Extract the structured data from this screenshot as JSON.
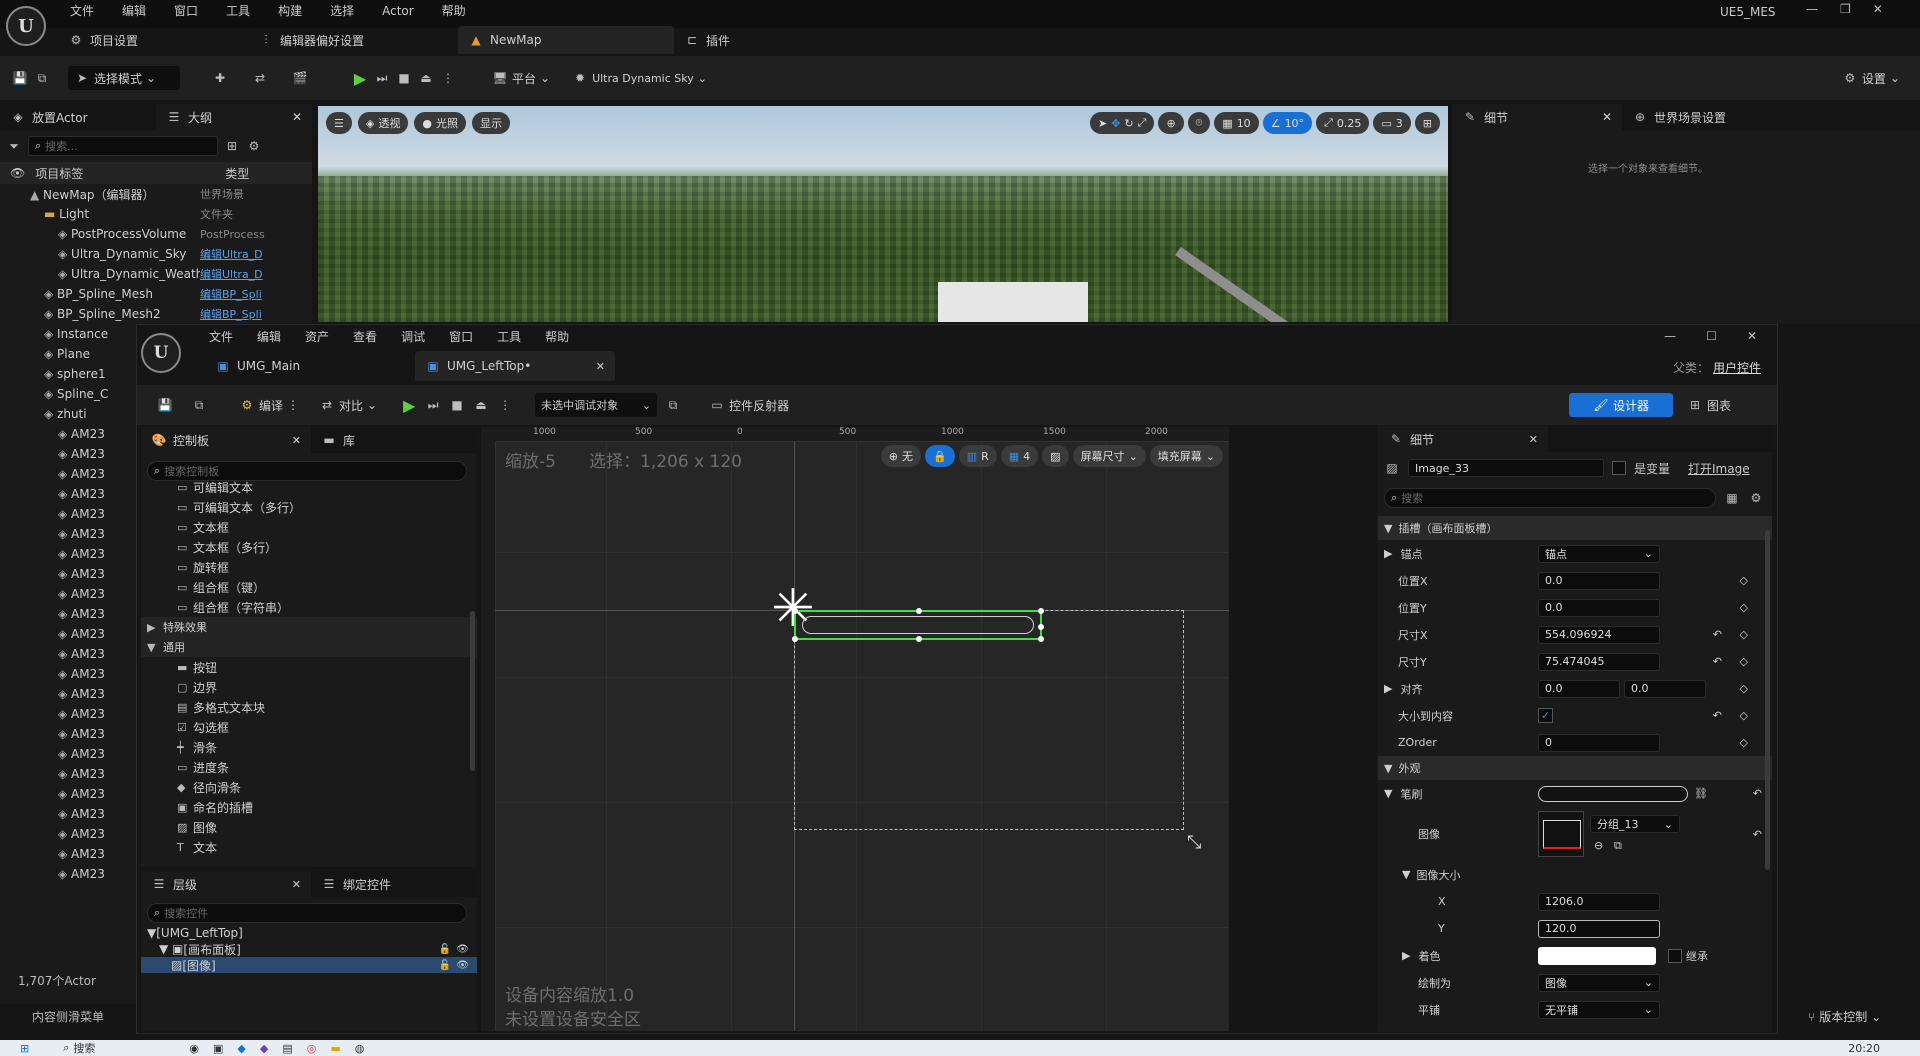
{
  "main_menu": [
    "文件",
    "编辑",
    "窗口",
    "工具",
    "构建",
    "选择",
    "Actor",
    "帮助"
  ],
  "project_name": "UE5_MES",
  "main_tabs": [
    {
      "label": "项目设置"
    },
    {
      "label": "编辑器偏好设置"
    },
    {
      "label": "NewMap"
    },
    {
      "label": "插件"
    }
  ],
  "main_toolbar": {
    "select_mode": "选择模式",
    "platform": "平台",
    "sky": "Ultra Dynamic Sky",
    "settings": "设置"
  },
  "left_panel": {
    "tab_place": "放置Actor",
    "tab_outline": "大纲",
    "search_placeholder": "搜索...",
    "col_label": "项目标签",
    "col_type": "类型",
    "rows": [
      {
        "label": "NewMap（编辑器）",
        "type": "世界场景",
        "indent": 0
      },
      {
        "label": "Light",
        "type": "文件夹",
        "indent": 1
      },
      {
        "label": "PostProcessVolume",
        "type": "PostProcess",
        "indent": 2
      },
      {
        "label": "Ultra_Dynamic_Sky",
        "type": "编辑Ultra_D",
        "indent": 2
      },
      {
        "label": "Ultra_Dynamic_Weath",
        "type": "编辑Ultra_D",
        "indent": 2
      },
      {
        "label": "BP_Spline_Mesh",
        "type": "编辑BP_Spli",
        "indent": 1
      },
      {
        "label": "BP_Spline_Mesh2",
        "type": "编辑BP_Spli",
        "indent": 1
      },
      {
        "label": "Instance",
        "type": "",
        "indent": 1
      },
      {
        "label": "Plane",
        "type": "",
        "indent": 1
      },
      {
        "label": "sphere1",
        "type": "",
        "indent": 1
      },
      {
        "label": "Spline_C",
        "type": "",
        "indent": 1
      },
      {
        "label": "zhuti",
        "type": "",
        "indent": 1
      },
      {
        "label": "AM23",
        "type": "",
        "indent": 2
      },
      {
        "label": "AM23",
        "type": "",
        "indent": 2
      },
      {
        "label": "AM23",
        "type": "",
        "indent": 2
      },
      {
        "label": "AM23",
        "type": "",
        "indent": 2
      },
      {
        "label": "AM23",
        "type": "",
        "indent": 2
      },
      {
        "label": "AM23",
        "type": "",
        "indent": 2
      },
      {
        "label": "AM23",
        "type": "",
        "indent": 2
      },
      {
        "label": "AM23",
        "type": "",
        "indent": 2
      },
      {
        "label": "AM23",
        "type": "",
        "indent": 2
      },
      {
        "label": "AM23",
        "type": "",
        "indent": 2
      },
      {
        "label": "AM23",
        "type": "",
        "indent": 2
      },
      {
        "label": "AM23",
        "type": "",
        "indent": 2
      },
      {
        "label": "AM23",
        "type": "",
        "indent": 2
      },
      {
        "label": "AM23",
        "type": "",
        "indent": 2
      },
      {
        "label": "AM23",
        "type": "",
        "indent": 2
      },
      {
        "label": "AM23",
        "type": "",
        "indent": 2
      },
      {
        "label": "AM23",
        "type": "",
        "indent": 2
      },
      {
        "label": "AM23",
        "type": "",
        "indent": 2
      },
      {
        "label": "AM23",
        "type": "",
        "indent": 2
      },
      {
        "label": "AM23",
        "type": "",
        "indent": 2
      },
      {
        "label": "AM23",
        "type": "",
        "indent": 2
      },
      {
        "label": "AM23",
        "type": "",
        "indent": 2
      },
      {
        "label": "AM23",
        "type": "",
        "indent": 2
      }
    ],
    "actor_count": "1,707个Actor",
    "content_drawer": "内容侧滑菜单"
  },
  "viewport": {
    "perspective": "透视",
    "lit": "光照",
    "show": "显示",
    "grid": "10",
    "angle": "10°",
    "scale": "0.25",
    "cam": "3"
  },
  "right_panel": {
    "tab_details": "细节",
    "tab_world": "世界场景设置",
    "hint": "选择一个对象来查看细节。"
  },
  "umg": {
    "menu": [
      "文件",
      "编辑",
      "资产",
      "查看",
      "调试",
      "窗口",
      "工具",
      "帮助"
    ],
    "tabs": [
      {
        "label": "UMG_Main"
      },
      {
        "label": "UMG_LeftTop•"
      }
    ],
    "parent_label": "父类：",
    "parent_value": "用户控件",
    "toolbar": {
      "compile": "编译",
      "diff": "对比",
      "debug_target": "未选中调试对象",
      "reflector": "控件反射器",
      "designer": "设计器",
      "graph": "图表"
    },
    "palette": {
      "tab": "控制板",
      "tab_lib": "库",
      "search_placeholder": "搜索控制板",
      "items": [
        {
          "label": "可编辑文本",
          "icon": "▭",
          "kind": "item"
        },
        {
          "label": "可编辑文本（多行）",
          "icon": "▭",
          "kind": "item"
        },
        {
          "label": "文本框",
          "icon": "▭",
          "kind": "item"
        },
        {
          "label": "文本框（多行）",
          "icon": "▭",
          "kind": "item"
        },
        {
          "label": "旋转框",
          "icon": "▭",
          "kind": "item"
        },
        {
          "label": "组合框（键）",
          "icon": "▭",
          "kind": "item"
        },
        {
          "label": "组合框（字符串）",
          "icon": "▭",
          "kind": "item"
        },
        {
          "label": "特殊效果",
          "icon": "▶",
          "kind": "cat"
        },
        {
          "label": "通用",
          "icon": "▼",
          "kind": "cat"
        },
        {
          "label": "按钮",
          "icon": "▬",
          "kind": "item"
        },
        {
          "label": "边界",
          "icon": "▢",
          "kind": "item"
        },
        {
          "label": "多格式文本块",
          "icon": "▤",
          "kind": "item"
        },
        {
          "label": "勾选框",
          "icon": "☑",
          "kind": "item"
        },
        {
          "label": "滑条",
          "icon": "┿",
          "kind": "item"
        },
        {
          "label": "进度条",
          "icon": "▭",
          "kind": "item"
        },
        {
          "label": "径向滑条",
          "icon": "◆",
          "kind": "item"
        },
        {
          "label": "命名的插槽",
          "icon": "▣",
          "kind": "item"
        },
        {
          "label": "图像",
          "icon": "▨",
          "kind": "item"
        },
        {
          "label": "文本",
          "icon": "T",
          "kind": "item"
        }
      ]
    },
    "hierarchy": {
      "tab": "层级",
      "tab_bind": "绑定控件",
      "search_placeholder": "搜索控件",
      "rows": [
        {
          "label": "[UMG_LeftTop]",
          "indent": 0
        },
        {
          "label": "[画布面板]",
          "indent": 1
        },
        {
          "label": "[图像]",
          "indent": 2
        }
      ]
    },
    "canvas": {
      "zoom": "缩放-5",
      "selection": "选择：1,206 x 120",
      "device_scale": "设备内容缩放1.0",
      "safe_zone": "未设置设备安全区",
      "ruler_marks": [
        "1000",
        "500",
        "0",
        "500",
        "1000",
        "1500",
        "2000"
      ],
      "no_label": "无",
      "r_label": "R",
      "grid_value": "4",
      "screen_size": "屏幕尺寸",
      "fill_screen": "填充屏幕"
    },
    "details": {
      "tab": "细节",
      "name_value": "Image_33",
      "is_variable": "是变量",
      "open_image": "打开Image",
      "search_placeholder": "搜索",
      "slot_header": "插槽（画布面板槽）",
      "anchor_label": "锚点",
      "anchor_value": "锚点",
      "pos_x_label": "位置X",
      "pos_x": "0.0",
      "pos_y_label": "位置Y",
      "pos_y": "0.0",
      "size_x_label": "尺寸X",
      "size_x": "554.096924",
      "size_y_label": "尺寸Y",
      "size_y": "75.474045",
      "align_label": "对齐",
      "align_x": "0.0",
      "align_y": "0.0",
      "autosize_label": "大小到内容",
      "zorder_label": "ZOrder",
      "zorder": "0",
      "appearance_header": "外观",
      "brush_label": "笔刷",
      "image_label": "图像",
      "image_value": "分组_13",
      "image_size_label": "图像大小",
      "img_x_label": "X",
      "img_x": "1206.0",
      "img_y_label": "Y",
      "img_y": "120.0",
      "tint_label": "着色",
      "inherit": "继承",
      "draw_as_label": "绘制为",
      "draw_as": "图像",
      "tiling_label": "平铺",
      "tiling": "无平铺"
    }
  },
  "status": {
    "version_control": "版本控制",
    "clock": "20:20"
  },
  "taskbar": {
    "search": "搜索"
  },
  "colors": {
    "accent": "#1a6fd4",
    "selection_green": "#3fe13f"
  }
}
